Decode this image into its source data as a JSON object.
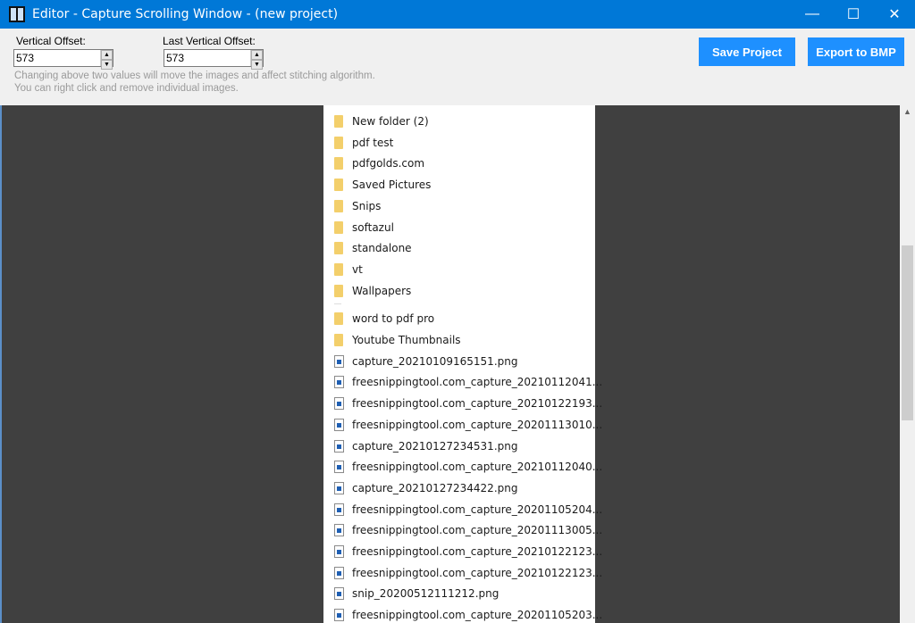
{
  "window": {
    "title": "Editor - Capture Scrolling Window - (new project)",
    "minimize": "—",
    "maximize": "☐",
    "close": "✕"
  },
  "toolbar": {
    "vertical_offset_label": "Vertical Offset:",
    "vertical_offset_value": "573",
    "last_vertical_offset_label": "Last Vertical Offset:",
    "last_vertical_offset_value": "573",
    "hint_line1": "Changing above two values will move the images and affect stitching algorithm.",
    "hint_line2": "You can right click and remove individual images.",
    "save_label": "Save Project",
    "export_label": "Export to BMP"
  },
  "items": [
    {
      "type": "folder",
      "name": "New folder (2)"
    },
    {
      "type": "folder",
      "name": "pdf test"
    },
    {
      "type": "folder",
      "name": "pdfgolds.com"
    },
    {
      "type": "folder",
      "name": "Saved Pictures"
    },
    {
      "type": "folder",
      "name": "Snips"
    },
    {
      "type": "folder",
      "name": "softazul"
    },
    {
      "type": "folder",
      "name": "standalone"
    },
    {
      "type": "folder",
      "name": "vt"
    },
    {
      "type": "folder",
      "name": "Wallpapers"
    },
    {
      "type": "folder",
      "name": "word to pdf pro"
    },
    {
      "type": "folder",
      "name": "Youtube Thumbnails"
    },
    {
      "type": "file",
      "name": "capture_20210109165151.png"
    },
    {
      "type": "file",
      "name": "freesnippingtool.com_capture_20210112041..."
    },
    {
      "type": "file",
      "name": "freesnippingtool.com_capture_20210122193..."
    },
    {
      "type": "file",
      "name": "freesnippingtool.com_capture_20201113010..."
    },
    {
      "type": "file",
      "name": "capture_20210127234531.png"
    },
    {
      "type": "file",
      "name": "freesnippingtool.com_capture_20210112040..."
    },
    {
      "type": "file",
      "name": "capture_20210127234422.png"
    },
    {
      "type": "file",
      "name": "freesnippingtool.com_capture_20201105204..."
    },
    {
      "type": "file",
      "name": "freesnippingtool.com_capture_20201113005..."
    },
    {
      "type": "file",
      "name": "freesnippingtool.com_capture_20210122123..."
    },
    {
      "type": "file",
      "name": "freesnippingtool.com_capture_20210122123..."
    },
    {
      "type": "file",
      "name": "snip_20200512111212.png"
    },
    {
      "type": "file",
      "name": "freesnippingtool.com_capture_20201105203..."
    }
  ],
  "colors": {
    "titlebar": "#0078d7",
    "button": "#1e90ff",
    "canvas": "#404040"
  }
}
